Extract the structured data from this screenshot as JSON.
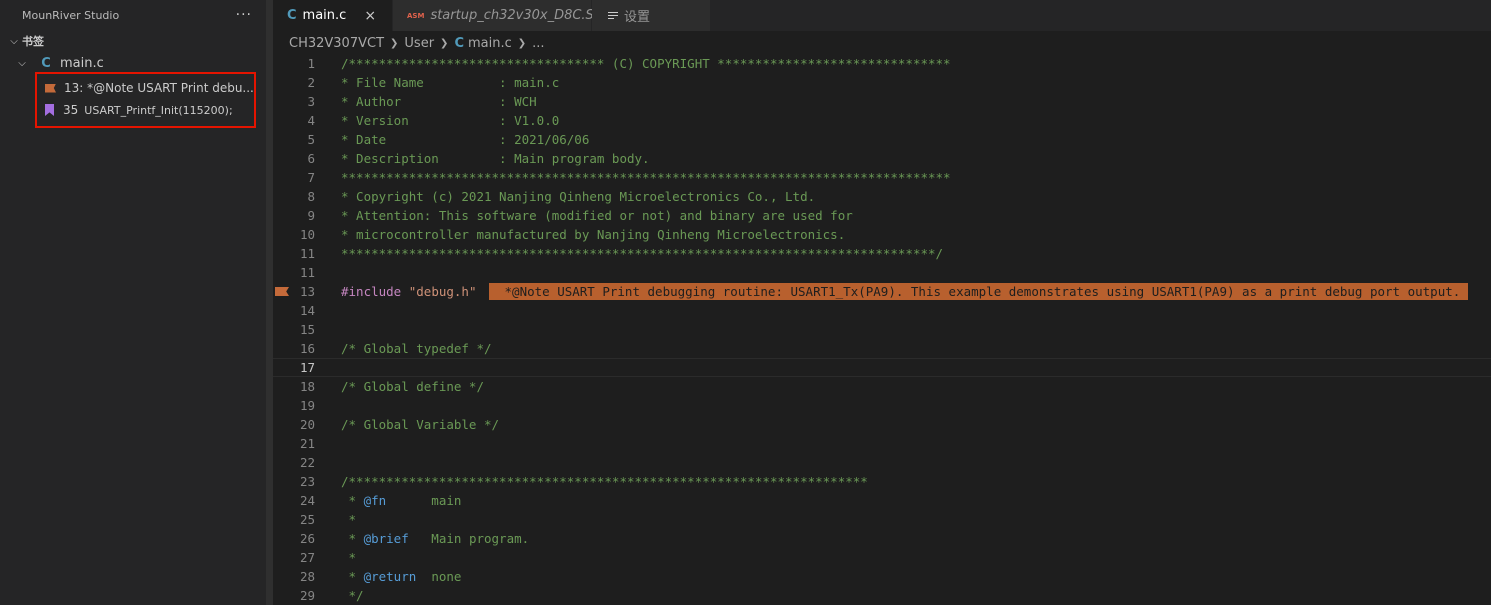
{
  "sidebar": {
    "title": "MounRiver Studio",
    "more": "···",
    "section": "书签",
    "file": "main.c",
    "bookmarks": [
      {
        "text": "13: *@Note  USART Print debu..."
      },
      {
        "num": "35",
        "label": "USART_Printf_Init(115200);"
      }
    ]
  },
  "tabs": [
    {
      "label": "main.c",
      "icon": "C",
      "close": "×"
    },
    {
      "label": "startup_ch32v30x_D8C.S",
      "icon": "ASM"
    },
    {
      "label": "设置"
    }
  ],
  "breadcrumb": [
    "CH32V307VCT",
    "User",
    "main.c",
    "..."
  ],
  "editor": {
    "current_line": "17",
    "bookmark_note": " *@Note USART Print debugging routine: USART1_Tx(PA9). This example demonstrates using USART1(PA9) as a print debug port output.",
    "lines": [
      {
        "n": "1",
        "t": "/********************************** (C) COPYRIGHT *******************************"
      },
      {
        "n": "2",
        "t": "* File Name          : main.c"
      },
      {
        "n": "3",
        "t": "* Author             : WCH"
      },
      {
        "n": "4",
        "t": "* Version            : V1.0.0"
      },
      {
        "n": "5",
        "t": "* Date               : 2021/06/06"
      },
      {
        "n": "6",
        "t": "* Description        : Main program body."
      },
      {
        "n": "7",
        "t": "*********************************************************************************"
      },
      {
        "n": "8",
        "t": "* Copyright (c) 2021 Nanjing Qinheng Microelectronics Co., Ltd."
      },
      {
        "n": "9",
        "t": "* Attention: This software (modified or not) and binary are used for "
      },
      {
        "n": "10",
        "t": "* microcontroller manufactured by Nanjing Qinheng Microelectronics."
      },
      {
        "n": "11",
        "t": "*******************************************************************************/"
      },
      {
        "n": "11",
        "t": ""
      },
      {
        "n": "13",
        "inc": "#include",
        "incfile": " \"debug.h\""
      },
      {
        "n": "14",
        "t": ""
      },
      {
        "n": "15",
        "t": ""
      },
      {
        "n": "16",
        "t": "/* Global typedef */"
      },
      {
        "n": "17",
        "t": ""
      },
      {
        "n": "18",
        "t": "/* Global define */"
      },
      {
        "n": "19",
        "t": ""
      },
      {
        "n": "20",
        "t": "/* Global Variable */"
      },
      {
        "n": "21",
        "t": ""
      },
      {
        "n": "22",
        "t": ""
      },
      {
        "n": "23",
        "t": "/*********************************************************************"
      },
      {
        "n": "24",
        "pre": " * ",
        "tag": "@fn",
        "post": "      main"
      },
      {
        "n": "25",
        "t": " *"
      },
      {
        "n": "26",
        "pre": " * ",
        "tag": "@brief",
        "post": "   Main program."
      },
      {
        "n": "27",
        "t": " *"
      },
      {
        "n": "28",
        "pre": " * ",
        "tag": "@return",
        "post": "  none"
      },
      {
        "n": "29",
        "t": " */"
      }
    ]
  },
  "colors": {
    "bookmark_orange": "#c46a3a",
    "bookmark_purple": "#a46ee0",
    "highlight_border": "#e51400",
    "comment_green": "#6a9955"
  }
}
